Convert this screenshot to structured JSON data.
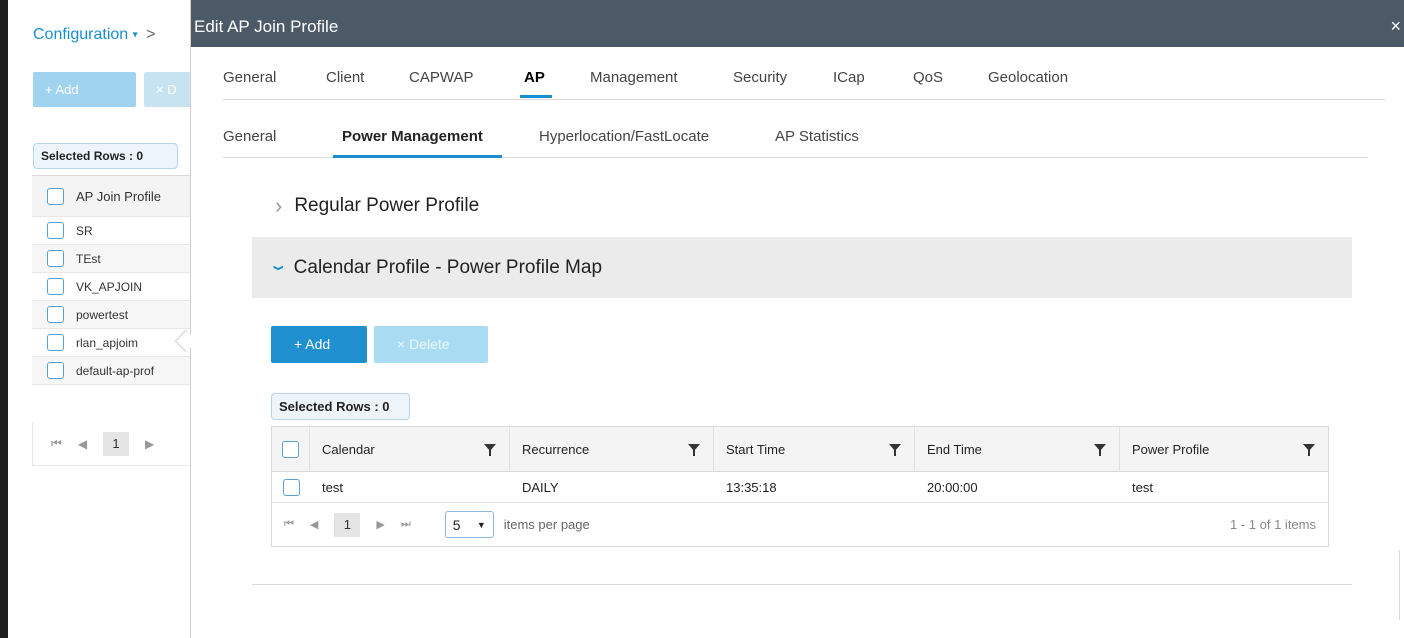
{
  "background": {
    "breadcrumb": "Configuration",
    "breadcrumb_caret": "▾",
    "breadcrumb_sep": ">",
    "add_label": "+ Add",
    "delete_label": "× D",
    "selected_rows": "Selected Rows : 0",
    "table": {
      "header": "AP Join Profile",
      "rows": [
        "SR",
        "TEst",
        "VK_APJOIN",
        "powertest",
        "rlan_apjoim",
        "default-ap-prof"
      ]
    },
    "pager": {
      "first": "⏮",
      "prev": "◀",
      "page": "1",
      "next": "▶",
      "last": "⏭"
    }
  },
  "modal": {
    "title": "Edit AP Join Profile",
    "close": "×",
    "tabs": [
      "General",
      "Client",
      "CAPWAP",
      "AP",
      "Management",
      "Security",
      "ICap",
      "QoS",
      "Geolocation"
    ],
    "active_tab": "AP",
    "subtabs": [
      "General",
      "Power Management",
      "Hyperlocation/FastLocate",
      "AP Statistics"
    ],
    "active_subtab": "Power Management",
    "regular_profile": "Regular Power Profile",
    "calendar_profile": "Calendar Profile - Power Profile Map",
    "add_label": "+ Add",
    "delete_label": "× Delete",
    "selected_rows": "Selected Rows : 0",
    "table": {
      "columns": [
        "Calendar",
        "Recurrence",
        "Start Time",
        "End Time",
        "Power Profile"
      ],
      "rows": [
        {
          "calendar": "test",
          "recurrence": "DAILY",
          "start": "13:35:18",
          "end": "20:00:00",
          "power_profile": "test"
        }
      ]
    },
    "pager": {
      "first": "⏮",
      "prev": "◀",
      "page": "1",
      "next": "▶",
      "last": "⏭",
      "per_page": "5",
      "per_page_label": "items per page",
      "count": "1 - 1 of 1 items"
    }
  },
  "colors": {
    "accent": "#1f8fd0",
    "header_bg": "#4c5a68"
  }
}
